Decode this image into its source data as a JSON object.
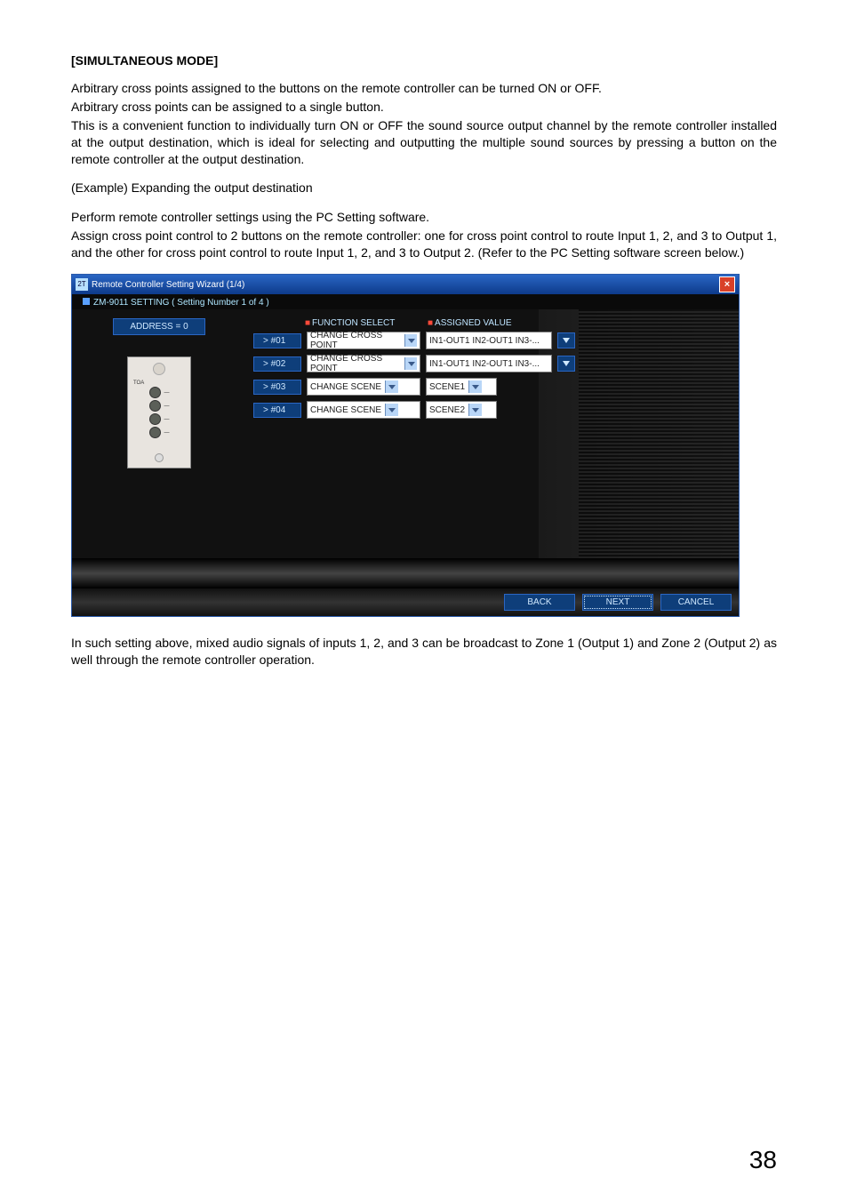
{
  "heading": "[SIMULTANEOUS MODE]",
  "para1_l1": "Arbitrary cross points assigned to the buttons on the remote controller can be turned ON or OFF.",
  "para1_l2": "Arbitrary cross points can be assigned to a single button.",
  "para2": "This is a convenient function to individually turn ON or OFF the sound source output channel by the remote controller installed at the output destination, which is ideal for selecting and outputting the multiple sound sources by pressing a button on the remote controller at the output destination.",
  "example": "(Example) Expanding the output destination",
  "para3_l1": "Perform remote controller settings using the PC Setting software.",
  "para3_l2": "Assign cross point control to 2 buttons on the remote controller: one for cross point control to route Input 1, 2, and 3 to Output 1, and the other for cross point control to route Input 1, 2, and 3 to Output 2. (Refer to the PC Setting software screen below.)",
  "para4": "In such setting above, mixed audio signals of inputs 1, 2, and 3 can be broadcast to Zone 1 (Output 1) and Zone 2 (Output 2) as well through the remote controller operation.",
  "page_num": "38",
  "wizard": {
    "title": "Remote Controller Setting Wizard (1/4)",
    "legend": "ZM-9011 SETTING  ( Setting Number 1 of 4 )",
    "address": "ADDRESS = 0",
    "brand": "TOA",
    "hdr_func": "FUNCTION SELECT",
    "hdr_val": "ASSIGNED VALUE",
    "rows": [
      {
        "id": "> #01",
        "func": "CHANGE CROSS POINT",
        "val": "IN1-OUT1 IN2-OUT1 IN3-...",
        "multi": true
      },
      {
        "id": "> #02",
        "func": "CHANGE CROSS POINT",
        "val": "IN1-OUT1 IN2-OUT1 IN3-...",
        "multi": true
      },
      {
        "id": "> #03",
        "func": "CHANGE SCENE",
        "val": "SCENE1",
        "multi": false
      },
      {
        "id": "> #04",
        "func": "CHANGE SCENE",
        "val": "SCENE2",
        "multi": false
      }
    ],
    "btn_back": "BACK",
    "btn_next": "NEXT",
    "btn_cancel": "CANCEL"
  }
}
